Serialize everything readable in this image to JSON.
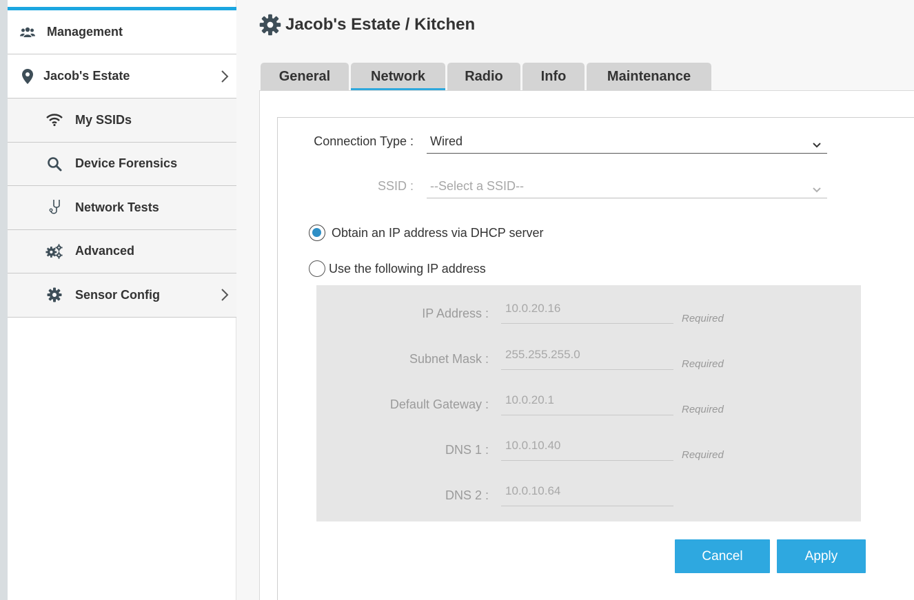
{
  "sidebar": {
    "items": [
      {
        "label": "Management",
        "icon": "users-icon"
      },
      {
        "label": "Jacob's Estate",
        "icon": "location-pin-icon"
      },
      {
        "label": "My SSIDs",
        "icon": "wifi-icon"
      },
      {
        "label": "Device Forensics",
        "icon": "search-icon"
      },
      {
        "label": "Network Tests",
        "icon": "stethoscope-icon"
      },
      {
        "label": "Advanced",
        "icon": "gears-icon"
      },
      {
        "label": "Sensor Config",
        "icon": "gear-icon"
      }
    ]
  },
  "header": {
    "title": "Jacob's Estate / Kitchen"
  },
  "tabs": [
    {
      "label": "General"
    },
    {
      "label": "Network",
      "active": true
    },
    {
      "label": "Radio"
    },
    {
      "label": "Info"
    },
    {
      "label": "Maintenance"
    }
  ],
  "form": {
    "connection_type_label": "Connection Type :",
    "connection_type_value": "Wired",
    "ssid_label": "SSID :",
    "ssid_placeholder": "--Select a SSID--",
    "dhcp_label": "Obtain an IP address via DHCP server",
    "static_label": "Use the following IP address",
    "selected_mode": "dhcp",
    "required_text": "Required",
    "fields": [
      {
        "label": "IP Address :",
        "value": "10.0.20.16",
        "required": true
      },
      {
        "label": "Subnet Mask :",
        "value": "255.255.255.0",
        "required": true
      },
      {
        "label": "Default Gateway :",
        "value": "10.0.20.1",
        "required": true
      },
      {
        "label": "DNS 1 :",
        "value": "10.0.10.40",
        "required": true
      },
      {
        "label": "DNS 2 :",
        "value": "10.0.10.64",
        "required": false
      }
    ]
  },
  "buttons": {
    "cancel": "Cancel",
    "apply": "Apply"
  },
  "colors": {
    "accent": "#2ea8e0",
    "sidebar_topbar": "#1ba6e0",
    "radio_fill": "#2e8fc6"
  }
}
